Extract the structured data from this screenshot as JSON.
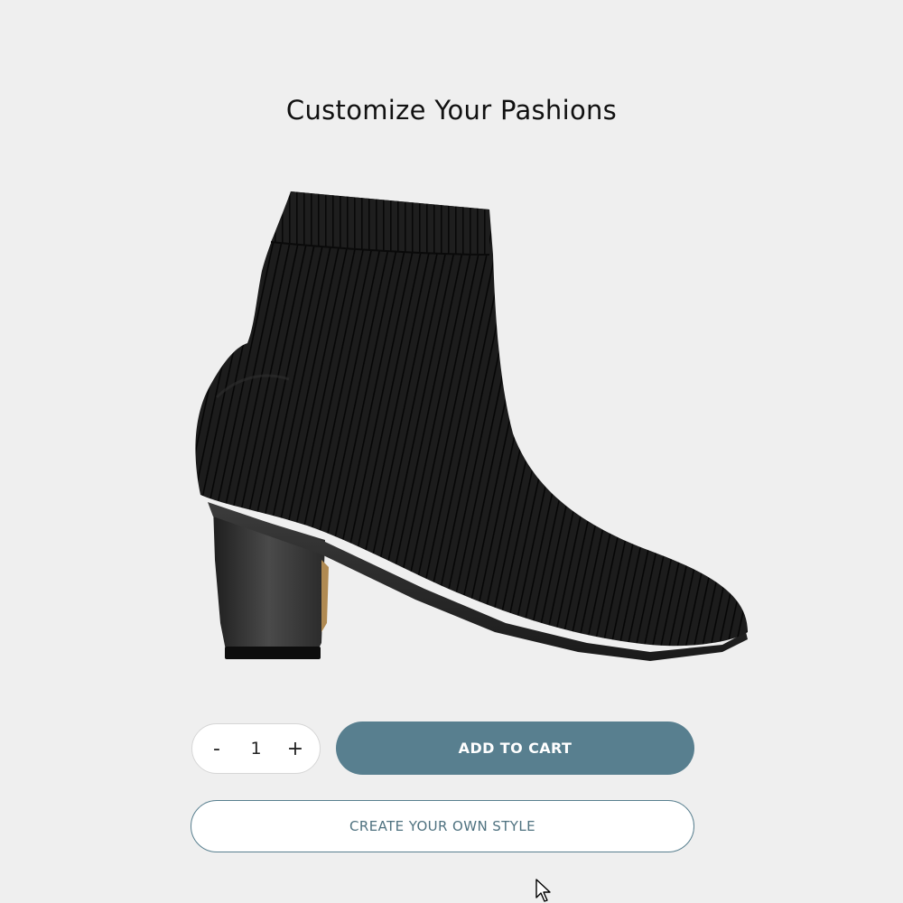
{
  "page": {
    "title": "Customize Your Pashions"
  },
  "product": {
    "image_alt": "Black ribbed knit ankle boot with block heel",
    "image_icon": "ankle-boot-image"
  },
  "quantity": {
    "decrement_label": "-",
    "value": "1",
    "increment_label": "+"
  },
  "actions": {
    "add_to_cart_label": "ADD TO CART",
    "create_style_label": "CREATE YOUR OWN STYLE"
  },
  "colors": {
    "background": "#efefef",
    "accent": "#587f8f",
    "boot": "#1a1a1a"
  }
}
